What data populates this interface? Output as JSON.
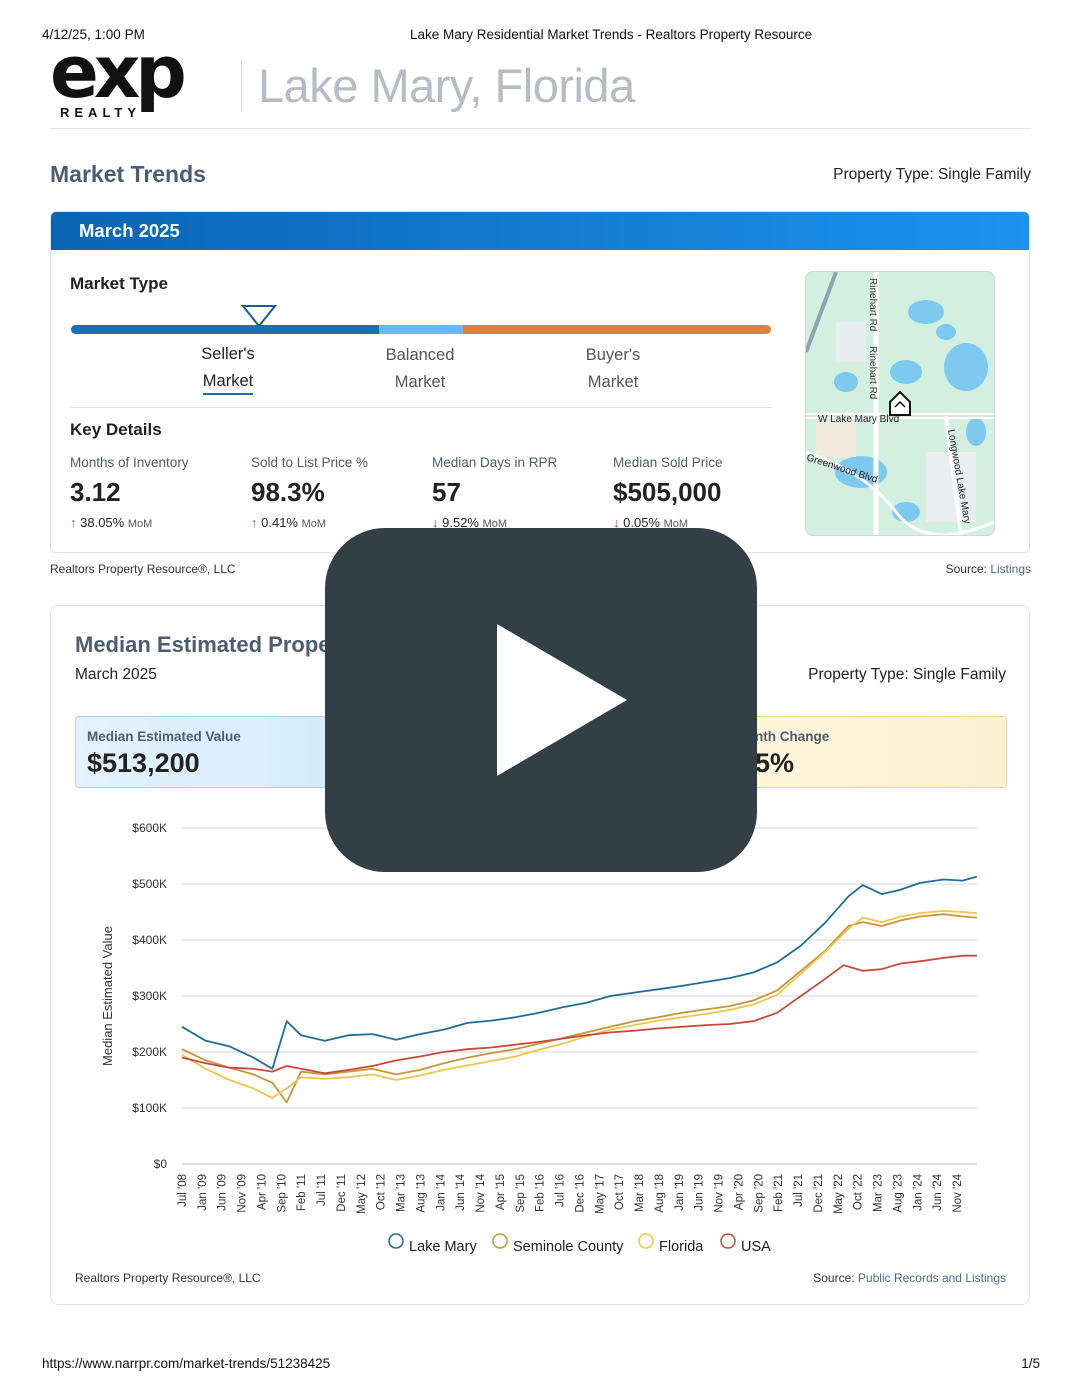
{
  "print_header": {
    "datetime": "4/12/25, 1:00 PM",
    "title": "Lake Mary Residential Market Trends - Realtors Property Resource"
  },
  "print_footer": {
    "url": "https://www.narrpr.com/market-trends/51238425",
    "page": "1/5"
  },
  "logo": {
    "brand": "exp",
    "sub": "REALTY"
  },
  "city_title": "Lake Mary, Florida",
  "market_trends": {
    "title": "Market Trends",
    "property_type_label": "Property Type:",
    "property_type_value": "Single Family",
    "month": "March 2025",
    "market_type_label": "Market Type",
    "options": [
      {
        "line1": "Seller's",
        "line2": "Market",
        "selected": true
      },
      {
        "line1": "Balanced",
        "line2": "Market",
        "selected": false
      },
      {
        "line1": "Buyer's",
        "line2": "Market",
        "selected": false
      }
    ],
    "segment_colors": {
      "seller": "#1a6fb8",
      "balanced": "#6ab8ee",
      "buyer": "#e87f33"
    },
    "key_details_label": "Key Details",
    "details": [
      {
        "label": "Months of Inventory",
        "value": "3.12",
        "change": "38.05%",
        "period": "MoM",
        "direction": "up"
      },
      {
        "label": "Sold to List Price %",
        "value": "98.3%",
        "change": "0.41%",
        "period": "MoM",
        "direction": "up"
      },
      {
        "label": "Median Days in RPR",
        "value": "57",
        "change": "9.52%",
        "period": "MoM",
        "direction": "down"
      },
      {
        "label": "Median Sold Price",
        "value": "$505,000",
        "change": "0.05%",
        "period": "MoM",
        "direction": "down"
      }
    ],
    "map_labels": [
      "Rinehart Rd",
      "Rinehart Rd",
      "W Lake Mary Blvd",
      "Greenwood Blvd",
      "Longwood Lake Mary"
    ],
    "footer_left": "Realtors Property Resource",
    "footer_left_suffix": "®, LLC",
    "footer_right_label": "Source:",
    "footer_right_value": "Listings"
  },
  "median_estimated": {
    "title": "Median Estimated Prope",
    "month": "March 2025",
    "property_type_label": "Property Type:",
    "property_type_value": "Single Family",
    "value_label": "Median Estimated Value",
    "value": "$513,200",
    "change_label": "nth Change",
    "change_value": "5%",
    "footer_left": "Realtors Property Resource",
    "footer_left_suffix": "®, LLC",
    "footer_right_label": "Source:",
    "footer_right_value": "Public Records and Listings"
  },
  "chart_data": {
    "type": "line",
    "ylabel": "Median Estimated Value",
    "xlabel": "",
    "ylim": [
      0,
      600000
    ],
    "yticks": [
      {
        "v": 0,
        "label": "$0"
      },
      {
        "v": 100000,
        "label": "$100K"
      },
      {
        "v": 200000,
        "label": "$200K"
      },
      {
        "v": 300000,
        "label": "$300K"
      },
      {
        "v": 400000,
        "label": "$400K"
      },
      {
        "v": 500000,
        "label": "$500K"
      },
      {
        "v": 600000,
        "label": "$600K"
      }
    ],
    "xticks": [
      "Jul '08",
      "Jan '09",
      "Jun '09",
      "Nov '09",
      "Apr '10",
      "Sep '10",
      "Feb '11",
      "Jul '11",
      "Dec '11",
      "May '12",
      "Oct '12",
      "Mar '13",
      "Aug '13",
      "Jan '14",
      "Jun '14",
      "Nov '14",
      "Apr '15",
      "Sep '15",
      "Feb '16",
      "Jul '16",
      "Dec '16",
      "May '17",
      "Oct '17",
      "Mar '18",
      "Aug '18",
      "Jan '19",
      "Jun '19",
      "Nov '19",
      "Apr '20",
      "Sep '20",
      "Feb '21",
      "Jul '21",
      "Dec '21",
      "May '22",
      "Oct '22",
      "Mar '23",
      "Aug '23",
      "Jan '24",
      "Jun '24",
      "Nov '24"
    ],
    "grid": true,
    "legend_position": "bottom",
    "series": [
      {
        "name": "Lake Mary",
        "color": "#1f6e99",
        "points": [
          [
            2008.5,
            245000
          ],
          [
            2009.0,
            220000
          ],
          [
            2009.5,
            210000
          ],
          [
            2010.0,
            190000
          ],
          [
            2010.4,
            170000
          ],
          [
            2010.7,
            255000
          ],
          [
            2011.0,
            230000
          ],
          [
            2011.5,
            220000
          ],
          [
            2012.0,
            230000
          ],
          [
            2012.5,
            232000
          ],
          [
            2013.0,
            222000
          ],
          [
            2013.5,
            232000
          ],
          [
            2014.0,
            240000
          ],
          [
            2014.5,
            252000
          ],
          [
            2015.0,
            256000
          ],
          [
            2015.5,
            262000
          ],
          [
            2016.0,
            270000
          ],
          [
            2016.5,
            280000
          ],
          [
            2017.0,
            288000
          ],
          [
            2017.5,
            300000
          ],
          [
            2018.0,
            306000
          ],
          [
            2018.5,
            312000
          ],
          [
            2019.0,
            318000
          ],
          [
            2019.5,
            325000
          ],
          [
            2020.0,
            332000
          ],
          [
            2020.5,
            342000
          ],
          [
            2021.0,
            360000
          ],
          [
            2021.5,
            390000
          ],
          [
            2022.0,
            430000
          ],
          [
            2022.5,
            478000
          ],
          [
            2022.8,
            498000
          ],
          [
            2023.2,
            482000
          ],
          [
            2023.6,
            490000
          ],
          [
            2024.0,
            502000
          ],
          [
            2024.5,
            508000
          ],
          [
            2024.9,
            506000
          ],
          [
            2025.2,
            513200
          ]
        ]
      },
      {
        "name": "Seminole County",
        "color": "#c8953b",
        "points": [
          [
            2008.5,
            205000
          ],
          [
            2009.0,
            185000
          ],
          [
            2009.5,
            172000
          ],
          [
            2010.0,
            160000
          ],
          [
            2010.4,
            145000
          ],
          [
            2010.7,
            110000
          ],
          [
            2011.0,
            165000
          ],
          [
            2011.5,
            160000
          ],
          [
            2012.0,
            165000
          ],
          [
            2012.5,
            170000
          ],
          [
            2013.0,
            160000
          ],
          [
            2013.5,
            168000
          ],
          [
            2014.0,
            180000
          ],
          [
            2014.5,
            190000
          ],
          [
            2015.0,
            198000
          ],
          [
            2015.5,
            205000
          ],
          [
            2016.0,
            215000
          ],
          [
            2016.5,
            225000
          ],
          [
            2017.0,
            235000
          ],
          [
            2017.5,
            245000
          ],
          [
            2018.0,
            255000
          ],
          [
            2018.5,
            262000
          ],
          [
            2019.0,
            270000
          ],
          [
            2019.5,
            276000
          ],
          [
            2020.0,
            282000
          ],
          [
            2020.5,
            292000
          ],
          [
            2021.0,
            310000
          ],
          [
            2021.5,
            345000
          ],
          [
            2022.0,
            380000
          ],
          [
            2022.5,
            425000
          ],
          [
            2022.8,
            432000
          ],
          [
            2023.2,
            425000
          ],
          [
            2023.6,
            435000
          ],
          [
            2024.0,
            442000
          ],
          [
            2024.5,
            446000
          ],
          [
            2024.9,
            442000
          ],
          [
            2025.2,
            440000
          ]
        ]
      },
      {
        "name": "Florida",
        "color": "#edc64a",
        "points": [
          [
            2008.5,
            195000
          ],
          [
            2009.0,
            170000
          ],
          [
            2009.5,
            150000
          ],
          [
            2010.0,
            135000
          ],
          [
            2010.4,
            118000
          ],
          [
            2010.7,
            135000
          ],
          [
            2011.0,
            155000
          ],
          [
            2011.5,
            152000
          ],
          [
            2012.0,
            155000
          ],
          [
            2012.5,
            160000
          ],
          [
            2013.0,
            150000
          ],
          [
            2013.5,
            158000
          ],
          [
            2014.0,
            168000
          ],
          [
            2014.5,
            176000
          ],
          [
            2015.0,
            184000
          ],
          [
            2015.5,
            192000
          ],
          [
            2016.0,
            204000
          ],
          [
            2016.5,
            215000
          ],
          [
            2017.0,
            228000
          ],
          [
            2017.5,
            240000
          ],
          [
            2018.0,
            248000
          ],
          [
            2018.5,
            256000
          ],
          [
            2019.0,
            262000
          ],
          [
            2019.5,
            268000
          ],
          [
            2020.0,
            275000
          ],
          [
            2020.5,
            285000
          ],
          [
            2021.0,
            302000
          ],
          [
            2021.5,
            340000
          ],
          [
            2022.0,
            378000
          ],
          [
            2022.5,
            420000
          ],
          [
            2022.8,
            440000
          ],
          [
            2023.2,
            432000
          ],
          [
            2023.6,
            442000
          ],
          [
            2024.0,
            448000
          ],
          [
            2024.5,
            452000
          ],
          [
            2024.9,
            450000
          ],
          [
            2025.2,
            448000
          ]
        ]
      },
      {
        "name": "USA",
        "color": "#c94a3c",
        "points": [
          [
            2008.5,
            190000
          ],
          [
            2009.0,
            180000
          ],
          [
            2009.5,
            172000
          ],
          [
            2010.0,
            170000
          ],
          [
            2010.4,
            165000
          ],
          [
            2010.7,
            175000
          ],
          [
            2011.0,
            170000
          ],
          [
            2011.5,
            162000
          ],
          [
            2012.0,
            168000
          ],
          [
            2012.5,
            175000
          ],
          [
            2013.0,
            185000
          ],
          [
            2013.5,
            192000
          ],
          [
            2014.0,
            200000
          ],
          [
            2014.5,
            205000
          ],
          [
            2015.0,
            208000
          ],
          [
            2015.5,
            213000
          ],
          [
            2016.0,
            218000
          ],
          [
            2016.5,
            224000
          ],
          [
            2017.0,
            230000
          ],
          [
            2017.5,
            235000
          ],
          [
            2018.0,
            238000
          ],
          [
            2018.5,
            242000
          ],
          [
            2019.0,
            245000
          ],
          [
            2019.5,
            248000
          ],
          [
            2020.0,
            250000
          ],
          [
            2020.5,
            255000
          ],
          [
            2021.0,
            270000
          ],
          [
            2021.5,
            300000
          ],
          [
            2022.0,
            330000
          ],
          [
            2022.4,
            355000
          ],
          [
            2022.8,
            345000
          ],
          [
            2023.2,
            348000
          ],
          [
            2023.6,
            358000
          ],
          [
            2024.0,
            362000
          ],
          [
            2024.5,
            368000
          ],
          [
            2024.9,
            372000
          ],
          [
            2025.2,
            372000
          ]
        ]
      }
    ]
  }
}
